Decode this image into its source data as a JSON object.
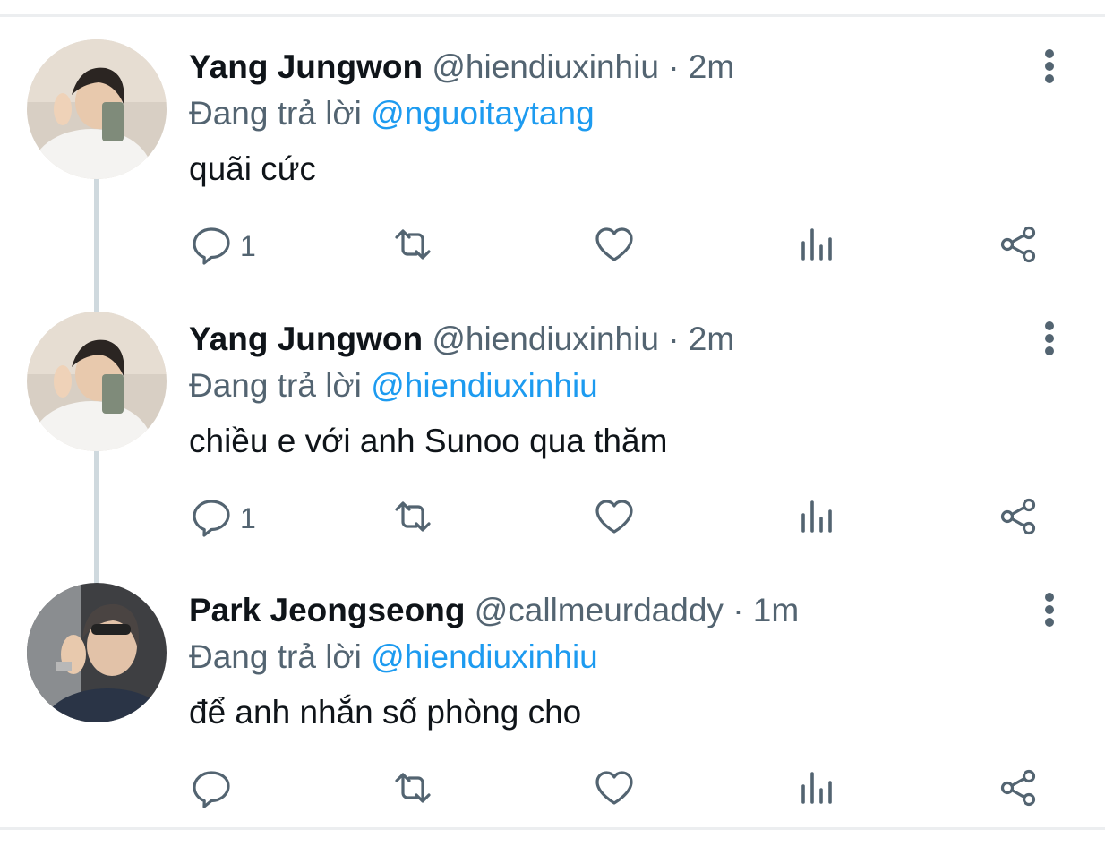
{
  "tweets": [
    {
      "name": "Yang Jungwon",
      "handle": "@hiendiuxinhiu",
      "separator": "·",
      "time": "2m",
      "replying_prefix": "Đang trả lời",
      "replying_to": "@nguoitaytang",
      "text": "quãi cức",
      "reply_count": "1"
    },
    {
      "name": "Yang Jungwon",
      "handle": "@hiendiuxinhiu",
      "separator": "·",
      "time": "2m",
      "replying_prefix": "Đang trả lời",
      "replying_to": "@hiendiuxinhiu",
      "text": "chiều e với anh Sunoo qua thăm",
      "reply_count": "1"
    },
    {
      "name": "Park Jeongseong",
      "handle": "@callmeurdaddy",
      "separator": "·",
      "time": "1m",
      "replying_prefix": "Đang trả lời",
      "replying_to": "@hiendiuxinhiu",
      "text": "để anh nhắn số phòng cho",
      "reply_count": ""
    }
  ],
  "icons": {
    "reply": "reply-icon",
    "retweet": "retweet-icon",
    "like": "heart-icon",
    "views": "views-icon",
    "share": "share-icon",
    "more": "more-vertical-icon"
  },
  "colors": {
    "text": "#0f1419",
    "secondary": "#536471",
    "mention": "#1d9bf0",
    "thread_line": "#cfd9de",
    "border": "#eceef0"
  }
}
